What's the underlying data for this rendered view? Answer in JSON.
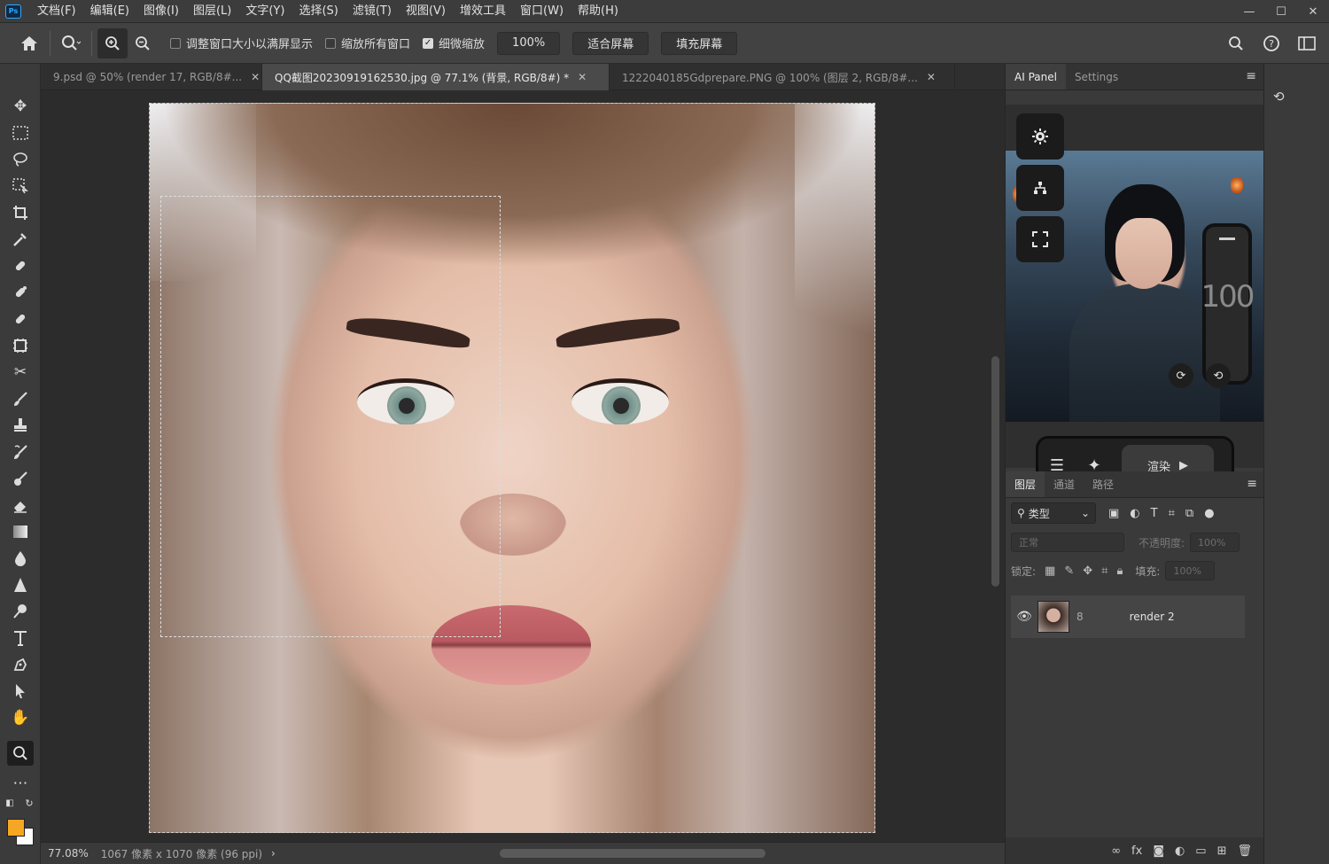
{
  "menubar": {
    "logo": "Ps",
    "items": [
      "文档(F)",
      "编辑(E)",
      "图像(I)",
      "图层(L)",
      "文字(Y)",
      "选择(S)",
      "滤镜(T)",
      "视图(V)",
      "增效工具",
      "窗口(W)",
      "帮助(H)"
    ],
    "window_controls": [
      "—",
      "☐",
      "✕"
    ]
  },
  "options": {
    "check1_label": "调整窗口大小以满屏显示",
    "check1_checked": false,
    "check2_label": "缩放所有窗口",
    "check2_checked": false,
    "check3_label": "细微缩放",
    "check3_checked": true,
    "btn_zoom100": "100%",
    "btn_fit": "适合屏幕",
    "btn_fill": "填充屏幕"
  },
  "doc_tabs": [
    {
      "label": "9.psd @ 50% (render 17, RGB/8#...",
      "active": false,
      "close": "✕"
    },
    {
      "label": "QQ截图20230919162530.jpg @ 77.1% (背景, RGB/8#) *",
      "active": true,
      "close": "✕"
    },
    {
      "label": "1222040185Gdprepare.PNG @ 100% (图层 2, RGB/8#...",
      "active": false,
      "close": "✕"
    }
  ],
  "statusbar": {
    "zoom": "77.08%",
    "doc_info": "1067 像素 x 1070 像素 (96 ppi)",
    "arrow": "›"
  },
  "ai_panel": {
    "tabs": [
      "AI Panel",
      "Settings"
    ],
    "slider_value": "100",
    "render_label": "渲染",
    "icons": [
      "gear-icon",
      "network-icon",
      "fullscreen-icon",
      "list-icon",
      "sparkle-icon",
      "play-icon",
      "refresh-icon",
      "crop-icon"
    ]
  },
  "layers_panel": {
    "tabs": [
      "图层",
      "通道",
      "路径"
    ],
    "filter_label": "类型",
    "blend_mode": "正常",
    "opacity_label": "不透明度:",
    "opacity_value": "100%",
    "lock_label": "锁定:",
    "fill_label": "填充:",
    "fill_value": "100%",
    "layer_name": "render 2",
    "footer_icons": [
      "link-icon",
      "fx-icon",
      "mask-icon",
      "adjustment-icon",
      "group-icon",
      "new-layer-icon",
      "delete-icon"
    ]
  },
  "colors": {
    "foreground": "#f5a623",
    "background": "#ffffff",
    "ui_bg": "#323232"
  }
}
